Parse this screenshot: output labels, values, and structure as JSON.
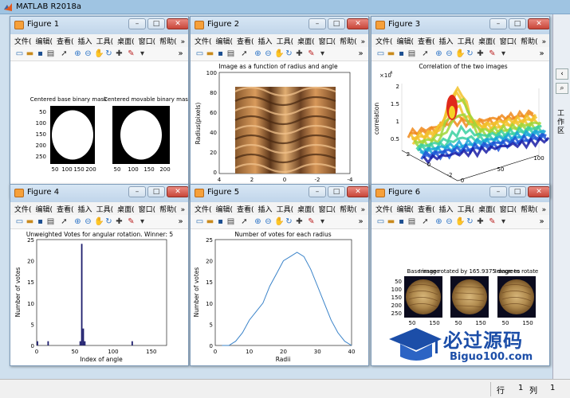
{
  "app": {
    "title": "MATLAB R2018a",
    "right_panel_label": "工作区",
    "statusbar": {
      "row_label": "行",
      "row_value": "1",
      "col_label": "列",
      "col_value": "1"
    }
  },
  "menu": [
    "文件(",
    "编辑(",
    "查看(",
    "插入",
    "工具(",
    "桌面(",
    "窗口(",
    "帮助("
  ],
  "toolbar_more": "»",
  "figures": [
    {
      "title": "Figure 1",
      "panels": [
        {
          "title": "Centered base binary mask",
          "yticks": [
            "50",
            "100",
            "150",
            "200",
            "250"
          ],
          "xticks": [
            "50",
            "100",
            "150",
            "200"
          ]
        },
        {
          "title": "Centered movable binary mask",
          "xticks": [
            "50",
            "100",
            "150",
            "200"
          ]
        }
      ]
    },
    {
      "title": "Figure 2",
      "plot": {
        "title": "Image as a function of radius and angle",
        "xlabel": "Theta (radians)",
        "ylabel": "Radius(pixels)",
        "xticks": [
          "4",
          "2",
          "0",
          "-2",
          "-4"
        ],
        "yticks": [
          "100",
          "80",
          "60",
          "40",
          "20",
          "0"
        ]
      }
    },
    {
      "title": "Figure 3",
      "plot": {
        "title": "Correlation of the two images",
        "zlabel": "correlation",
        "exponent": "×10",
        "exponent_power": "4",
        "zticks": [
          "2",
          "1.5",
          "1",
          "0.5"
        ],
        "xlabel": "angle",
        "ylabel": "radius",
        "xticks": [
          "2",
          "0",
          "-2"
        ],
        "yticks": [
          "0",
          "50",
          "100"
        ]
      }
    },
    {
      "title": "Figure 4",
      "plot": {
        "title": "Unweighted Votes for angular rotation. Winner: 5",
        "xlabel": "Index of angle",
        "ylabel": "Number of votes",
        "xticks": [
          "0",
          "50",
          "100",
          "150"
        ],
        "yticks": [
          "25",
          "20",
          "15",
          "10",
          "5",
          "0"
        ]
      }
    },
    {
      "title": "Figure 5",
      "plot": {
        "title": "Number of votes for each radius",
        "xlabel": "Radii",
        "ylabel": "Number of votes",
        "xticks": [
          "0",
          "10",
          "20",
          "30",
          "40"
        ],
        "yticks": [
          "25",
          "20",
          "15",
          "10",
          "5",
          "0"
        ]
      }
    },
    {
      "title": "Figure 6",
      "panels": [
        {
          "title": "Base image",
          "yticks": [
            "50",
            "100",
            "150",
            "200",
            "250"
          ],
          "xticks": [
            "50",
            "150"
          ]
        },
        {
          "title": "Image rotated by 165.9375 degrees",
          "xticks": [
            "50",
            "150"
          ]
        },
        {
          "title": "Image to rotate",
          "xticks": [
            "50",
            "150"
          ]
        }
      ]
    }
  ],
  "chart_data": [
    {
      "type": "bar",
      "title": "Unweighted Votes for angular rotation. Winner: 5",
      "xlabel": "Index of angle",
      "ylabel": "Number of votes",
      "xlim": [
        0,
        170
      ],
      "ylim": [
        0,
        25
      ],
      "x": [
        1,
        15,
        57,
        59,
        61,
        63,
        125
      ],
      "values": [
        1,
        1,
        1,
        24,
        4,
        1,
        1
      ],
      "color": "#1f1f6e"
    },
    {
      "type": "line",
      "title": "Number of votes for each radius",
      "xlabel": "Radii",
      "ylabel": "Number of votes",
      "xlim": [
        0,
        40
      ],
      "ylim": [
        0,
        25
      ],
      "x": [
        2,
        4,
        6,
        8,
        10,
        12,
        14,
        16,
        18,
        20,
        22,
        24,
        26,
        28,
        30,
        32,
        34,
        36,
        38,
        40
      ],
      "y": [
        0,
        0,
        1,
        3,
        6,
        8,
        10,
        14,
        17,
        20,
        21,
        22,
        21,
        18,
        14,
        10,
        6,
        3,
        1,
        0
      ],
      "color": "#3a83c9"
    }
  ],
  "watermark": {
    "title": "必过源码",
    "url": "Biguo100.com"
  }
}
